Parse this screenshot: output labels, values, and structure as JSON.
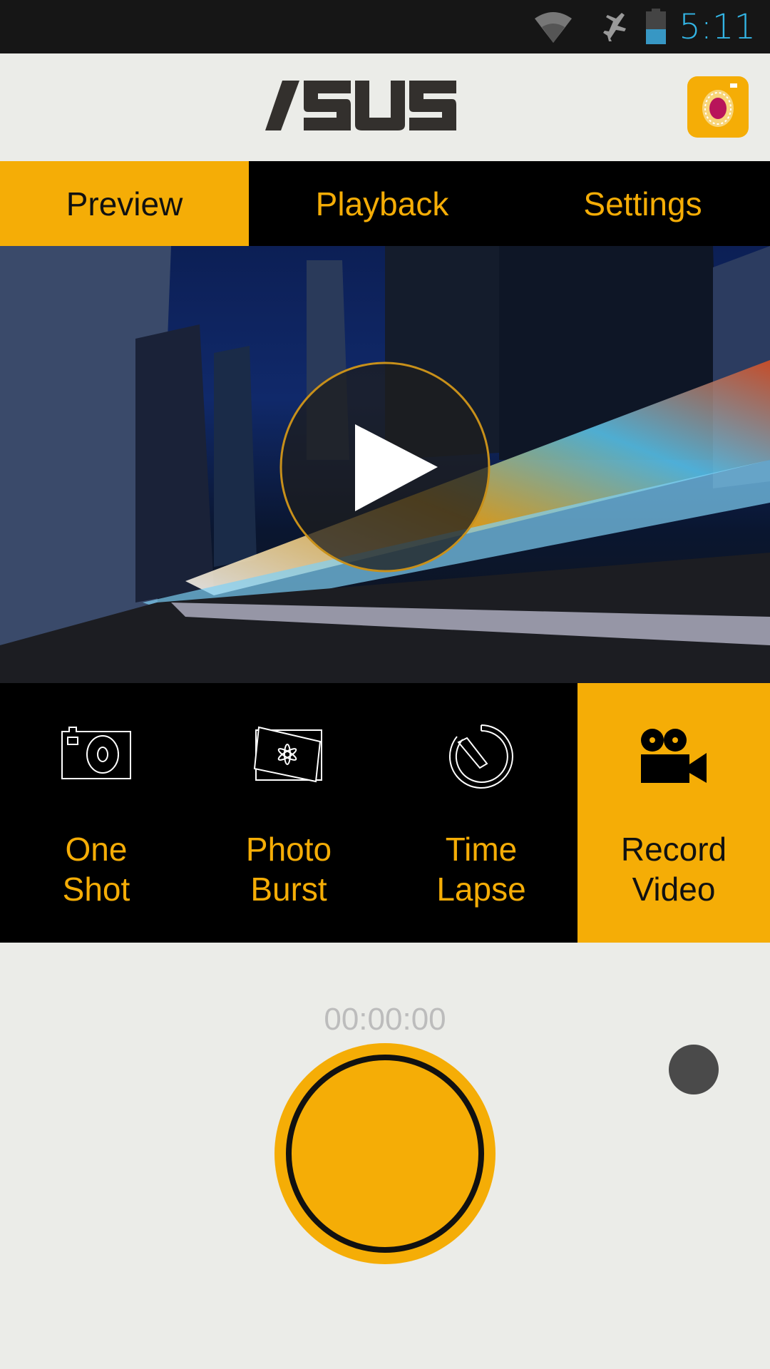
{
  "status_bar": {
    "time": "5:11",
    "icons": [
      "wifi-icon",
      "airplane-mode-icon",
      "battery-icon"
    ],
    "time_color": "#33b5e5"
  },
  "header": {
    "logo": "ASUS",
    "camera_app_icon": "camera-app-icon"
  },
  "tabs": [
    {
      "label": "Preview",
      "active": true
    },
    {
      "label": "Playback",
      "active": false
    },
    {
      "label": "Settings",
      "active": false
    }
  ],
  "preview": {
    "play_icon": "play-icon"
  },
  "modes": [
    {
      "line1": "One",
      "line2": "Shot",
      "icon": "camera-icon",
      "active": false
    },
    {
      "line1": "Photo",
      "line2": "Burst",
      "icon": "photo-burst-icon",
      "active": false
    },
    {
      "line1": "Time",
      "line2": "Lapse",
      "icon": "timer-icon",
      "active": false
    },
    {
      "line1": "Record",
      "line2": "Video",
      "icon": "video-camera-icon",
      "active": true
    }
  ],
  "recorder": {
    "elapsed": "00:00:00"
  },
  "colors": {
    "accent": "#f5ad06",
    "background": "#ebece8",
    "bar": "#000000"
  }
}
